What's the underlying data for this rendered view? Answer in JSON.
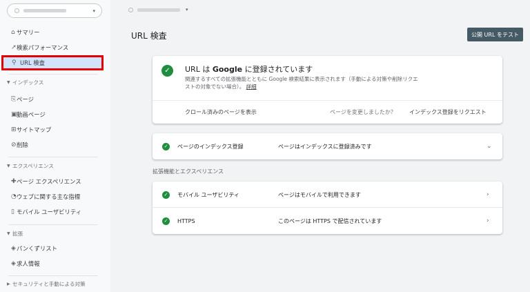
{
  "sidebar": {
    "items": [
      {
        "icon": "home-icon",
        "glyph": "⌂",
        "label": "サマリー"
      },
      {
        "icon": "trend-icon",
        "glyph": "↗",
        "label": "検索パフォーマンス"
      },
      {
        "icon": "search-icon",
        "glyph": "⚲",
        "label": "URL 検査"
      }
    ],
    "sections": [
      {
        "label": "インデックス",
        "items": [
          {
            "icon": "page-icon",
            "glyph": "⎘",
            "label": "ページ"
          },
          {
            "icon": "video-page-icon",
            "glyph": "▣",
            "label": "動画ページ"
          },
          {
            "icon": "sitemap-icon",
            "glyph": "⊞",
            "label": "サイトマップ"
          },
          {
            "icon": "remove-icon",
            "glyph": "⊘",
            "label": "削除"
          }
        ]
      },
      {
        "label": "エクスペリエンス",
        "items": [
          {
            "icon": "page-experience-icon",
            "glyph": "✚",
            "label": "ページ エクスペリエンス"
          },
          {
            "icon": "web-vitals-icon",
            "glyph": "◔",
            "label": "ウェブに関する主な指標"
          },
          {
            "icon": "mobile-icon",
            "glyph": "▯",
            "label": "モバイル ユーザビリティ"
          }
        ]
      },
      {
        "label": "拡張",
        "items": [
          {
            "icon": "breadcrumb-icon",
            "glyph": "◈",
            "label": "パンくずリスト"
          },
          {
            "icon": "job-icon",
            "glyph": "◈",
            "label": "求人情報"
          }
        ]
      }
    ],
    "collapsed_section": "セキュリティと手動による対策"
  },
  "header": {
    "title": "URL 検査",
    "test_button": "公開 URL をテスト"
  },
  "status_card": {
    "headline_prefix": "URL は ",
    "headline_brand": "Google",
    "headline_suffix": " に登録されています",
    "description": "関連するすべての拡張機能とともに Google 検索結果に表示されます（手動による対策や削除リクエストの対象でない場合）。",
    "description_link": "詳細",
    "view_crawled": "クロール済みのページを表示",
    "changed_question": "ページを変更しましたか？",
    "request_indexing": "インデックス登録をリクエスト"
  },
  "index_row": {
    "label": "ページのインデックス登録",
    "value": "ページはインデックスに登録済みです"
  },
  "enhancements": {
    "heading": "拡張機能とエクスペリエンス",
    "rows": [
      {
        "label": "モバイル ユーザビリティ",
        "value": "ページはモバイルで利用できます"
      },
      {
        "label": "HTTPS",
        "value": "このページは HTTPS で配信されています"
      }
    ]
  },
  "colors": {
    "accent_button": "#455a64",
    "success": "#1e8e3e",
    "active_bg": "#d2e3fc",
    "highlight_border": "#e30000"
  }
}
